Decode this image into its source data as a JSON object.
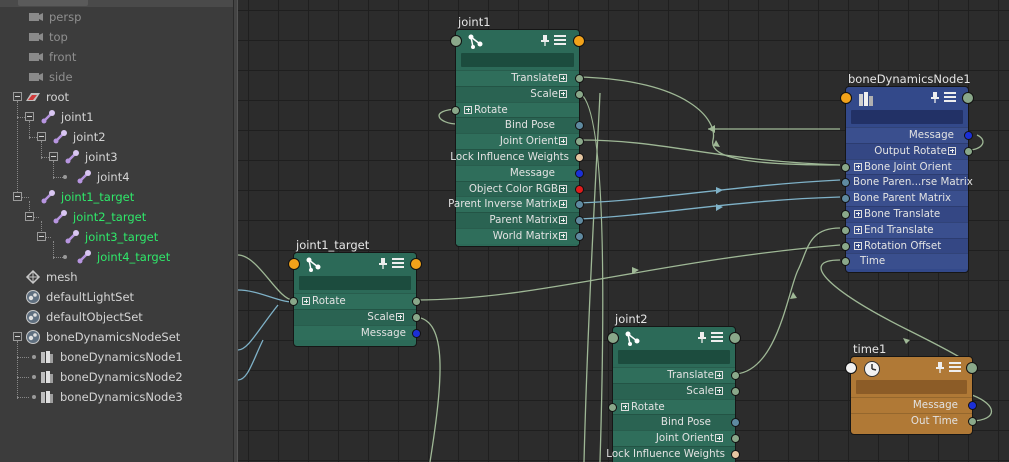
{
  "outliner": {
    "items": [
      {
        "label": "persp",
        "icon": "camera-icon",
        "kind": "camera"
      },
      {
        "label": "top",
        "icon": "camera-icon",
        "kind": "camera"
      },
      {
        "label": "front",
        "icon": "camera-icon",
        "kind": "camera"
      },
      {
        "label": "side",
        "icon": "camera-icon",
        "kind": "camera"
      },
      {
        "label": "root",
        "icon": "root-transform-icon",
        "kind": "node"
      },
      {
        "label": "joint1",
        "icon": "joint-icon",
        "kind": "node"
      },
      {
        "label": "joint2",
        "icon": "joint-icon",
        "kind": "node"
      },
      {
        "label": "joint3",
        "icon": "joint-icon",
        "kind": "node"
      },
      {
        "label": "joint4",
        "icon": "joint-icon",
        "kind": "node"
      },
      {
        "label": "joint1_target",
        "icon": "joint-icon",
        "kind": "target"
      },
      {
        "label": "joint2_target",
        "icon": "joint-icon",
        "kind": "target"
      },
      {
        "label": "joint3_target",
        "icon": "joint-icon",
        "kind": "target"
      },
      {
        "label": "joint4_target",
        "icon": "joint-icon",
        "kind": "target"
      },
      {
        "label": "mesh",
        "icon": "mesh-icon",
        "kind": "node"
      },
      {
        "label": "defaultLightSet",
        "icon": "set-icon",
        "kind": "node"
      },
      {
        "label": "defaultObjectSet",
        "icon": "set-icon",
        "kind": "node"
      },
      {
        "label": "boneDynamicsNodeSet",
        "icon": "set-icon",
        "kind": "node"
      },
      {
        "label": "boneDynamicsNode1",
        "icon": "bone-dynamics-icon",
        "kind": "node"
      },
      {
        "label": "boneDynamicsNode2",
        "icon": "bone-dynamics-icon",
        "kind": "node"
      },
      {
        "label": "boneDynamicsNode3",
        "icon": "bone-dynamics-icon",
        "kind": "node"
      }
    ]
  },
  "node_editor": {
    "nodes": {
      "joint1": {
        "title": "joint1",
        "attrs": [
          "Translate",
          "Scale",
          "Rotate",
          "Bind Pose",
          "Joint Orient",
          "Lock Influence Weights",
          "Message",
          "Object Color RGB",
          "Parent Inverse Matrix",
          "Parent Matrix",
          "World Matrix"
        ]
      },
      "joint1_target": {
        "title": "joint1_target",
        "attrs": [
          "Rotate",
          "Scale",
          "Message"
        ]
      },
      "joint2": {
        "title": "joint2",
        "attrs": [
          "Translate",
          "Scale",
          "Rotate",
          "Bind Pose",
          "Joint Orient",
          "Lock Influence Weights"
        ]
      },
      "boneDynamicsNode1": {
        "title": "boneDynamicsNode1",
        "attrs": [
          "Message",
          "Output Rotate",
          "Bone Joint Orient",
          "Bone Paren...rse Matrix",
          "Bone Parent Matrix",
          "Bone Translate",
          "End Translate",
          "Rotation Offset",
          "Time"
        ]
      },
      "time1": {
        "title": "time1",
        "attrs": [
          "Message",
          "Out Time"
        ]
      }
    }
  },
  "colors": {
    "joint_node": "#2c6a58",
    "bone_dynamics_node": "#33498a",
    "time_node": "#b07936",
    "target_label": "#2fe86a",
    "wire_green": "#9fb896",
    "wire_blue": "#7fb2c8"
  }
}
